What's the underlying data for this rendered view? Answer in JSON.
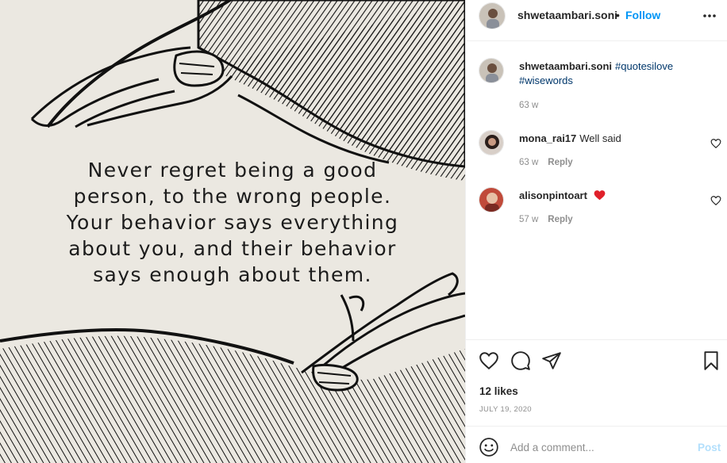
{
  "post": {
    "quote_lines": [
      "Never regret being a good",
      "person, to the wrong people.",
      "Your behavior says everything",
      "about you, and their behavior",
      "says enough about them."
    ]
  },
  "header": {
    "username": "shwetaambari.soni",
    "separator": "•",
    "follow_label": "Follow",
    "more_icon": "more-options-icon"
  },
  "caption": {
    "username": "shwetaambari.soni",
    "tags": "#quotesilove #wisewords",
    "time": "63 w"
  },
  "comments": [
    {
      "username": "mona_rai17",
      "text": "Well said",
      "time": "63 w",
      "reply_label": "Reply",
      "emoji": ""
    },
    {
      "username": "alisonpintoart",
      "text": "",
      "time": "57 w",
      "reply_label": "Reply",
      "emoji": "red-heart"
    }
  ],
  "actions": {
    "like_icon": "heart-icon",
    "comment_icon": "comment-icon",
    "share_icon": "share-icon",
    "save_icon": "bookmark-icon",
    "likes": "12 likes",
    "date": "JULY 19, 2020"
  },
  "add_comment": {
    "placeholder": "Add a comment...",
    "post_label": "Post",
    "emoji_icon": "smiley-icon"
  },
  "colors": {
    "link_blue": "#0095f6",
    "hashtag": "#00376b",
    "muted": "#8e8e8e",
    "post_disabled": "#b2dffc",
    "heart_red": "#ed4956"
  }
}
